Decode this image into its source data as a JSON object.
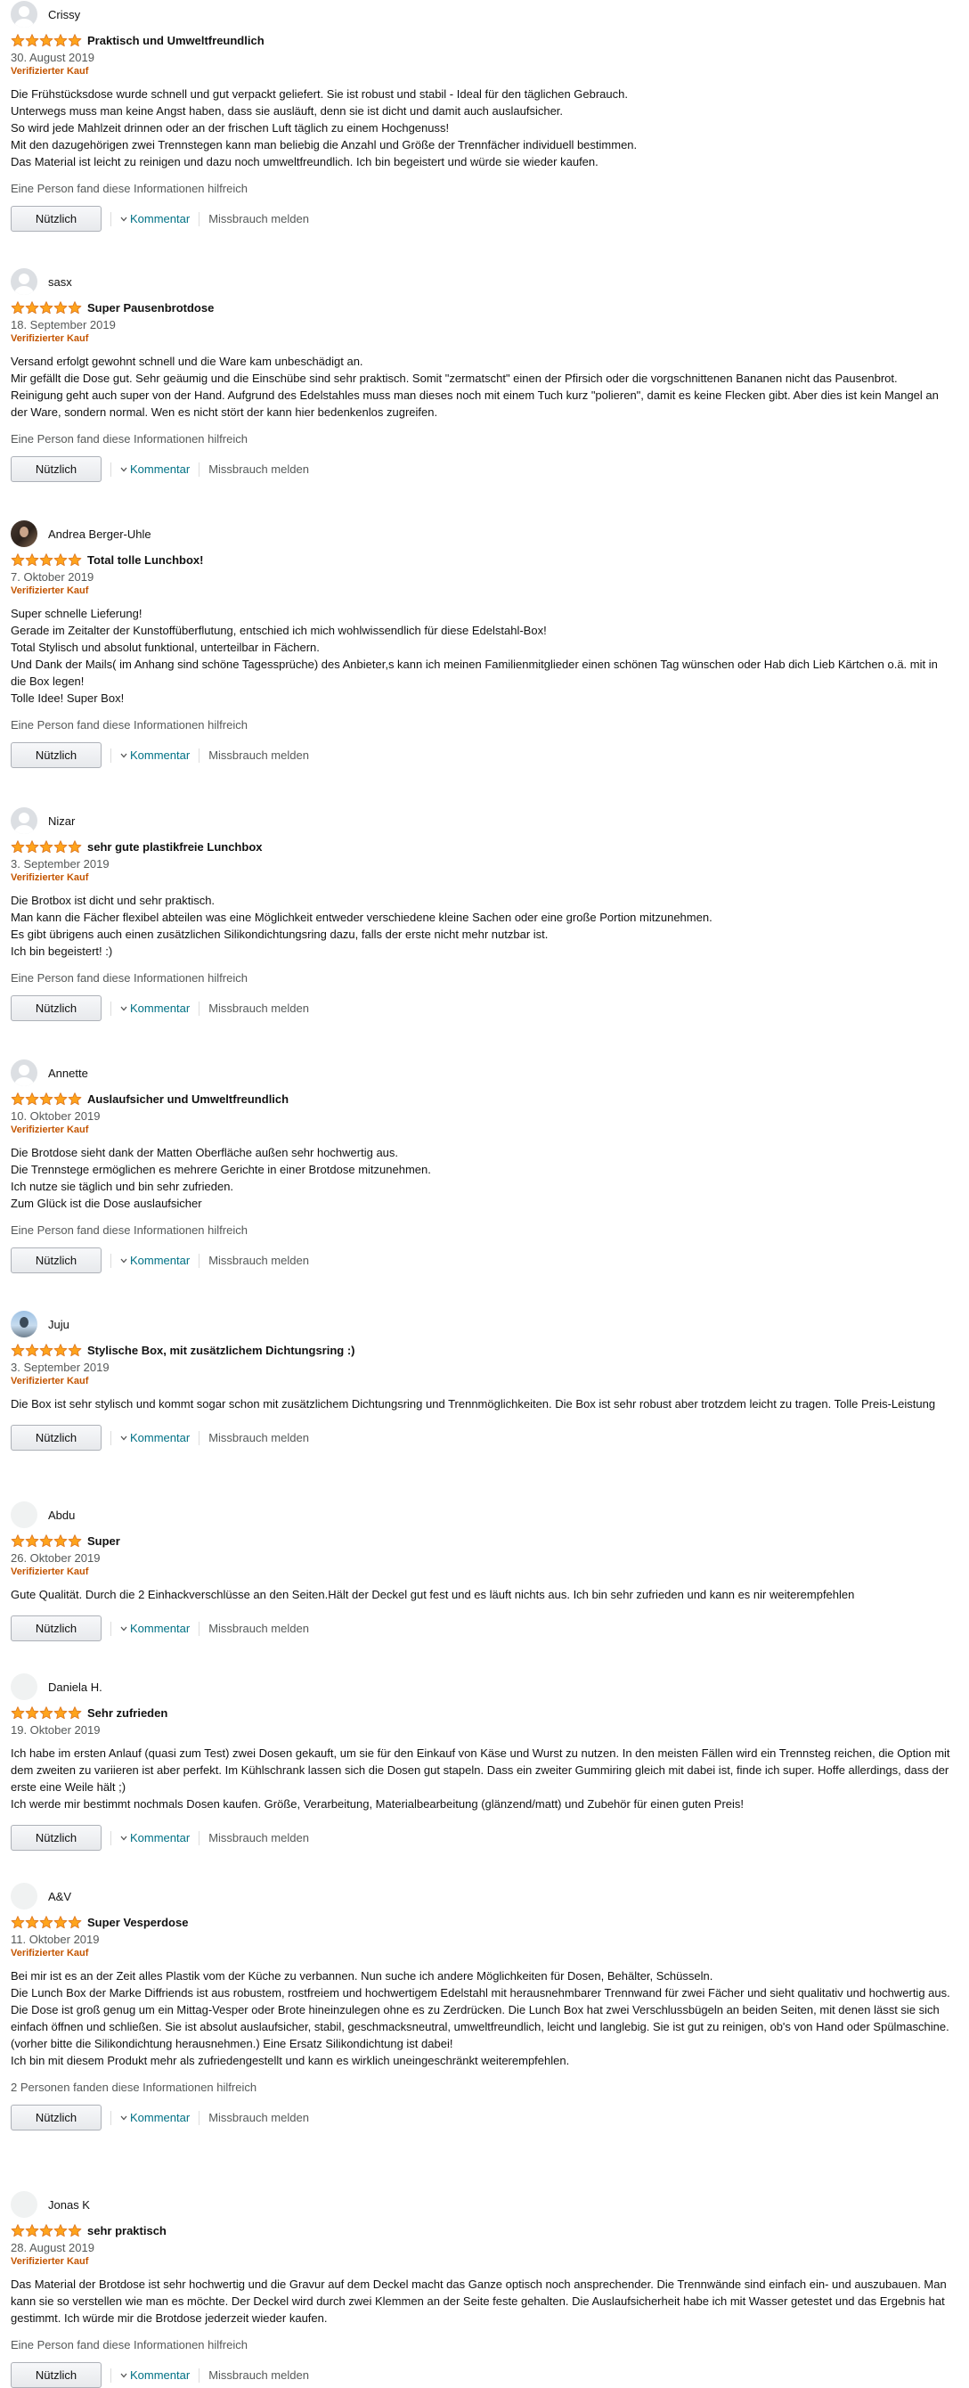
{
  "reviews": [
    {
      "name": "Crissy",
      "avatar": "default-avatar-icon",
      "rating": 5,
      "title": "Praktisch und Umweltfreundlich",
      "date": "30. August 2019",
      "verified": "Verifizierter Kauf",
      "body": [
        "Die Frühstücksdose wurde schnell und gut verpackt geliefert. Sie ist robust und stabil - Ideal für den täglichen Gebrauch.",
        "Unterwegs muss man keine Angst haben, dass sie ausläuft, denn sie ist dicht und damit auch auslaufsicher.",
        "So wird jede Mahlzeit drinnen oder an der frischen Luft täglich zu einem Hochgenuss!",
        "Mit den dazugehörigen zwei Trennstegen kann man beliebig die Anzahl und Größe der Trennfächer individuell bestimmen.",
        "Das Material ist leicht zu reinigen und dazu noch umweltfreundlich. Ich bin begeistert und würde sie wieder kaufen."
      ],
      "helpful": "Eine Person fand diese Informationen hilfreich"
    },
    {
      "name": "sasx",
      "avatar": "default-avatar-icon",
      "rating": 5,
      "title": "Super Pausenbrotdose",
      "date": "18. September 2019",
      "verified": "Verifizierter Kauf",
      "body": [
        "Versand erfolgt gewohnt schnell und die Ware kam unbeschädigt an.",
        "Mir gefällt die Dose gut. Sehr geäumig und die Einschübe sind sehr praktisch. Somit \"zermatscht\" einen der Pfirsich oder die vorgschnittenen Bananen nicht das Pausenbrot.",
        "Reinigung geht auch super von der Hand. Aufgrund des Edelstahles muss man dieses noch mit einem Tuch kurz \"polieren\", damit es keine Flecken gibt. Aber dies ist kein Mangel an der Ware, sondern normal. Wen es nicht stört der kann hier bedenkenlos zugreifen."
      ],
      "helpful": "Eine Person fand diese Informationen hilfreich"
    },
    {
      "name": "Andrea Berger-Uhle",
      "avatar": "user-photo-avatar",
      "rating": 5,
      "title": "Total tolle Lunchbox!",
      "date": "7. Oktober 2019",
      "verified": "Verifizierter Kauf",
      "body": [
        "Super schnelle Lieferung!",
        "Gerade im Zeitalter der Kunstoffüberflutung, entschied ich mich wohlwissendlich für diese Edelstahl-Box!",
        "Total Stylisch und absolut funktional, unterteilbar in Fächern.",
        "Und Dank der Mails( im Anhang sind schöne Tagessprüche) des Anbieter,s kann ich meinen Familienmitglieder einen schönen Tag wünschen oder Hab dich Lieb Kärtchen o.ä. mit in die Box legen!",
        "Tolle Idee! Super Box!"
      ],
      "helpful": "Eine Person fand diese Informationen hilfreich"
    },
    {
      "name": "Nizar",
      "avatar": "default-avatar-icon",
      "rating": 5,
      "title": "sehr gute plastikfreie Lunchbox",
      "date": "3. September 2019",
      "verified": "Verifizierter Kauf",
      "body": [
        "Die Brotbox ist dicht und sehr praktisch.",
        "Man kann die Fächer flexibel abteilen was eine Möglichkeit entweder verschiedene kleine Sachen oder eine große Portion mitzunehmen.",
        "Es gibt übrigens auch einen zusätzlichen Silikondichtungsring dazu, falls der erste nicht mehr nutzbar ist.",
        "Ich bin begeistert! :)"
      ],
      "helpful": "Eine Person fand diese Informationen hilfreich"
    },
    {
      "name": "Annette",
      "avatar": "default-avatar-icon",
      "rating": 5,
      "title": "Auslaufsicher und Umweltfreundlich",
      "date": "10. Oktober 2019",
      "verified": "Verifizierter Kauf",
      "body": [
        "Die Brotdose sieht dank der Matten Oberfläche außen sehr hochwertig aus.",
        "Die Trennstege ermöglichen es mehrere Gerichte in einer Brotdose mitzunehmen.",
        "Ich nutze sie täglich und bin sehr zufrieden.",
        "Zum Glück ist die Dose auslaufsicher"
      ],
      "helpful": "Eine Person fand diese Informationen hilfreich"
    },
    {
      "name": "Juju",
      "avatar": "user-photo-avatar",
      "rating": 5,
      "title": "Stylische Box, mit zusätzlichem Dichtungsring :)",
      "date": "3. September 2019",
      "verified": "Verifizierter Kauf",
      "body": [
        "Die Box ist sehr stylisch und kommt sogar schon mit zusätzlichem Dichtungsring und Trennmöglichkeiten. Die Box ist sehr robust aber trotzdem leicht zu tragen. Tolle Preis-Leistung"
      ],
      "helpful": ""
    },
    {
      "name": "Abdu",
      "avatar": "blank-avatar",
      "rating": 5,
      "title": "Super",
      "date": "26. Oktober 2019",
      "verified": "Verifizierter Kauf",
      "body": [
        "Gute Qualität. Durch die 2 Einhackverschlüsse an den Seiten.Hält der Deckel gut fest und es läuft nichts aus. Ich bin sehr zufrieden und kann es nir weiterempfehlen"
      ],
      "helpful": ""
    },
    {
      "name": "Daniela H.",
      "avatar": "blank-avatar",
      "rating": 5,
      "title": "Sehr zufrieden",
      "date": "19. Oktober 2019",
      "verified": "",
      "body": [
        "Ich habe im ersten Anlauf (quasi zum Test) zwei Dosen gekauft, um sie für den Einkauf von Käse und Wurst zu nutzen. In den meisten Fällen wird ein Trennsteg reichen, die Option mit dem zweiten zu variieren ist aber perfekt. Im Kühlschrank lassen sich die Dosen gut stapeln. Dass ein zweiter Gummiring gleich mit dabei ist, finde ich super. Hoffe allerdings, dass der erste eine Weile hält ;)",
        "Ich werde mir bestimmt nochmals Dosen kaufen. Größe, Verarbeitung, Materialbearbeitung (glänzend/matt) und Zubehör für einen guten Preis!"
      ],
      "helpful": ""
    },
    {
      "name": "A&V",
      "avatar": "blank-avatar",
      "rating": 5,
      "title": "Super Vesperdose",
      "date": "11. Oktober 2019",
      "verified": "Verifizierter Kauf",
      "body": [
        "Bei mir ist es an der Zeit alles Plastik vom der Küche zu verbannen. Nun suche ich andere Möglichkeiten für Dosen, Behälter, Schüsseln.",
        "Die Lunch Box der Marke Diffriends ist aus robustem, rostfreiem und hochwertigem Edelstahl mit herausnehmbarer Trennwand für zwei Fächer und sieht qualitativ und hochwertig aus.",
        "Die Dose ist groß genug um ein Mittag-Vesper oder Brote hineinzulegen ohne es zu Zerdrücken. Die Lunch Box hat zwei Verschlussbügeln an beiden Seiten, mit denen lässt sie sich einfach öffnen und schließen. Sie ist absolut auslaufsicher, stabil, geschmacksneutral, umweltfreundlich, leicht und langlebig. Sie ist gut zu reinigen, ob's von Hand oder Spülmaschine. (vorher bitte die Silikondichtung herausnehmen.) Eine Ersatz Silikondichtung ist dabei!",
        "Ich bin mit diesem Produkt mehr als zufriedengestellt und kann es wirklich uneingeschränkt weiterempfehlen."
      ],
      "helpful": "2 Personen fanden diese Informationen hilfreich"
    },
    {
      "name": "Jonas K",
      "avatar": "blank-avatar",
      "rating": 5,
      "title": "sehr praktisch",
      "date": "28. August 2019",
      "verified": "Verifizierter Kauf",
      "body": [
        "Das Material der Brotdose ist sehr hochwertig und die Gravur auf dem Deckel macht das Ganze optisch noch ansprechender. Die Trennwände sind einfach ein- und auszubauen. Man kann sie so verstellen wie man es möchte. Der Deckel wird durch zwei Klemmen an der Seite feste gehalten. Die Auslaufsicherheit habe ich mit Wasser getestet und das Ergebnis hat gestimmt. Ich würde mir die Brotdose jederzeit wieder kaufen."
      ],
      "helpful": "Eine Person fand diese Informationen hilfreich"
    }
  ],
  "actions": {
    "helpful_button": "Nützlich",
    "comment_link": "Kommentar",
    "report_link": "Missbrauch melden"
  },
  "colors": {
    "star": "#FFA41C",
    "star_border": "#DE7921",
    "verified": "#C45500",
    "link": "#007185",
    "muted": "#565959"
  }
}
